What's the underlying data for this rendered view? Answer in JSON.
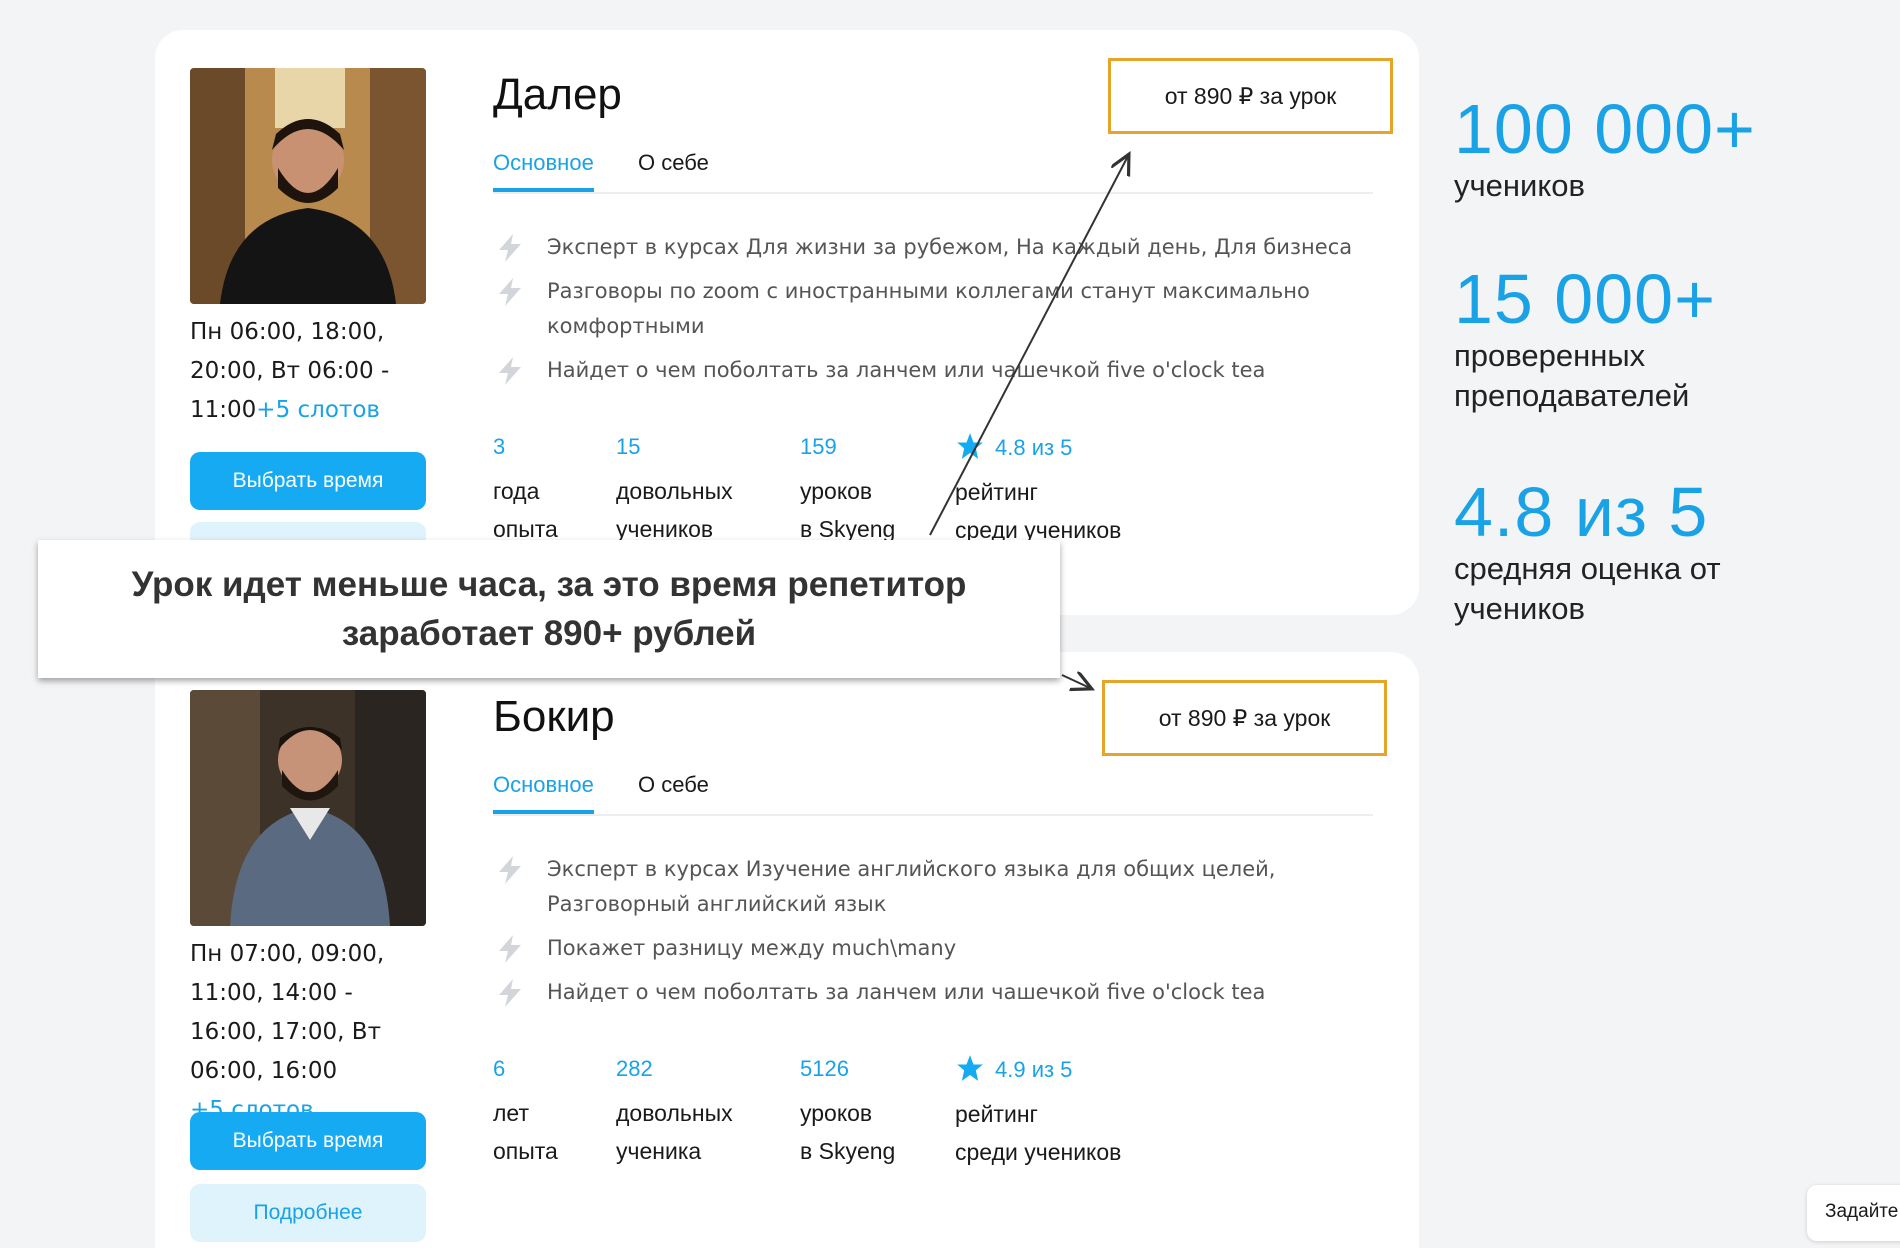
{
  "tutors": [
    {
      "name": "Далер",
      "price": "от 890 ₽ за урок",
      "tabs": [
        "Основное",
        "О себе"
      ],
      "schedule_text": "Пн 06:00, 18:00, 20:00, Вт 06:00 - 11:00",
      "slots": "+5 слотов",
      "choose_time": "Выбрать время",
      "features": [
        "Эксперт в курсах Для жизни за рубежом, На каждый день, Для бизнеса",
        "Разговоры по zoom с иностранными коллегами станут максимально комфортными",
        "Найдет о чем поболтать за ланчем или чашечкой five o'clock tea"
      ],
      "stats": [
        {
          "value": "3",
          "label1": "года",
          "label2": "опыта"
        },
        {
          "value": "15",
          "label1": "довольных",
          "label2": "учеников"
        },
        {
          "value": "159",
          "label1": "уроков",
          "label2": "в Skyeng"
        },
        {
          "value": "4.8 из 5",
          "label1": "рейтинг",
          "label2": "среди учеников"
        }
      ]
    },
    {
      "name": "Бокир",
      "price": "от 890 ₽ за урок",
      "tabs": [
        "Основное",
        "О себе"
      ],
      "schedule_text": "Пн 07:00, 09:00, 11:00, 14:00 - 16:00, 17:00, Вт 06:00, 16:00",
      "slots": "+5 слотов",
      "choose_time": "Выбрать время",
      "more": "Подробнее",
      "features": [
        "Эксперт в курсах Изучение английского языка для общих целей, Разговорный английский язык",
        "Покажет разницу между much\\many",
        "Найдет о чем поболтать за ланчем или чашечкой five o'clock tea"
      ],
      "stats": [
        {
          "value": "6",
          "label1": "лет",
          "label2": "опыта"
        },
        {
          "value": "282",
          "label1": "довольных",
          "label2": "ученика"
        },
        {
          "value": "5126",
          "label1": "уроков",
          "label2": "в Skyeng"
        },
        {
          "value": "4.9 из 5",
          "label1": "рейтинг",
          "label2": "среди учеников"
        }
      ]
    }
  ],
  "overlay": {
    "text": "Урок идет меньше часа, за это время репетитор заработает 890+ рублей"
  },
  "side_stats": [
    {
      "value": "100 000+",
      "label": "учеников"
    },
    {
      "value": "15 000+",
      "label": "проверенных преподавателей"
    },
    {
      "value": "4.8 из 5",
      "label": "средняя оценка от учеников"
    }
  ],
  "help_button": "Задайте",
  "colors": {
    "accent": "#16aaf2",
    "price_border": "#e6a428",
    "page_bg": "#f3f4f6"
  },
  "icons": [
    "bolt-icon",
    "star-icon"
  ]
}
